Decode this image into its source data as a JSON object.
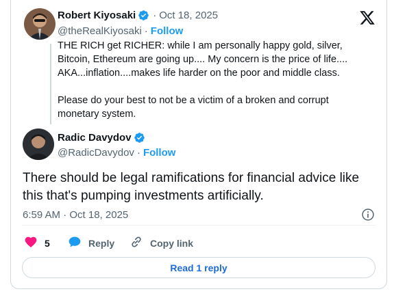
{
  "original": {
    "author_name": "Robert Kiyosaki",
    "sep": "·",
    "date": "Oct 18, 2025",
    "handle": "@theRealKiyosaki",
    "follow_label": "Follow",
    "text_lines": [
      "THE RICH get RICHER:  while I am personally happy gold, silver,",
      "Bitcoin, Ethereum are going up.... My concern is the price of life....",
      "AKA...inflation....makes life harder on the poor and middle class.",
      "",
      "Please do your best to not be a victim of a broken and corrupt",
      "monetary system."
    ]
  },
  "reply": {
    "author_name": "Radic Davydov",
    "handle": "@RadicDavydov",
    "sep": "·",
    "follow_label": "Follow",
    "text_lines": [
      "There should be legal ramifications for financial advice like",
      "this that's pumping investments artificially."
    ],
    "timestamp": "6:59 AM · Oct 18, 2025"
  },
  "actions": {
    "like_count": "5",
    "reply_label": "Reply",
    "copy_link_label": "Copy link"
  },
  "read_replies_label": "Read 1 reply",
  "colors": {
    "accent": "#1d9bf0",
    "like": "#f91880",
    "muted": "#536471"
  },
  "icons": [
    "x-logo-icon",
    "verified-badge-icon",
    "heart-icon",
    "reply-bubble-icon",
    "link-icon",
    "info-icon"
  ]
}
